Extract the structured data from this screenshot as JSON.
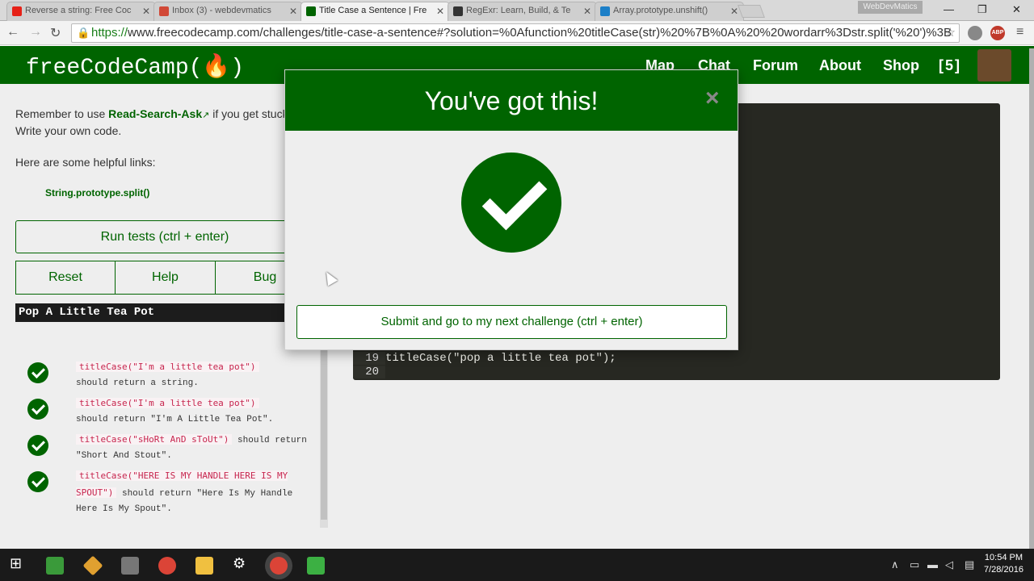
{
  "browser": {
    "tabs": [
      {
        "title": "Reverse a string: Free Coc",
        "color": "#e62117"
      },
      {
        "title": "Inbox (3) - webdevmatics",
        "color": "#d14836"
      },
      {
        "title": "Title Case a Sentence | Fre",
        "color": "#006400"
      },
      {
        "title": "RegExr: Learn, Build, & Te",
        "color": "#333333"
      },
      {
        "title": "Array.prototype.unshift()",
        "color": "#1c7fc7"
      }
    ],
    "profile": "WebDevMatics",
    "url_scheme": "https://",
    "url_rest": "www.freecodecamp.com/challenges/title-case-a-sentence#?solution=%0Afunction%20titleCase(str)%20%7B%0A%20%20wordarr%3Dstr.split('%20')%3B",
    "ext_label": "ABP"
  },
  "nav": {
    "logo": "freeCodeCamp(🔥)",
    "links": [
      "Map",
      "Chat",
      "Forum",
      "About",
      "Shop",
      "[5]"
    ]
  },
  "left": {
    "remember_prefix": "Remember to use",
    "rsa_link": "Read-Search-Ask",
    "remember_suffix": "if you get stuck.",
    "write_own": "Write your own code.",
    "helpful": "Here are some helpful links:",
    "link1": "String.prototype.split()",
    "run_tests": "Run tests (ctrl + enter)",
    "reset": "Reset",
    "help": "Help",
    "bug": "Bug",
    "output": "Pop A Little Tea Pot",
    "tests": [
      {
        "code": "titleCase(\"I'm a little tea pot\")",
        "text": "should return a string."
      },
      {
        "code": "titleCase(\"I'm a little tea pot\")",
        "text": "should return \"I'm A Little Tea Pot\"."
      },
      {
        "code": "titleCase(\"sHoRt AnD sToUt\")",
        "text": "should return \"Short And Stout\"."
      },
      {
        "code": "titleCase(\"HERE IS MY HANDLE HERE IS MY SPOUT\")",
        "text": "should return \"Here Is My Handle Here Is My Spout\"."
      }
    ]
  },
  "editor": {
    "lines": [
      {
        "num": "19",
        "code": "titleCase(\"pop a little tea pot\");"
      },
      {
        "num": "20",
        "code": ""
      }
    ]
  },
  "modal": {
    "title": "You've got this!",
    "close": "×",
    "submit": "Submit and go to my next challenge (ctrl + enter)"
  },
  "taskbar": {
    "time": "10:54 PM",
    "date": "7/28/2016"
  }
}
